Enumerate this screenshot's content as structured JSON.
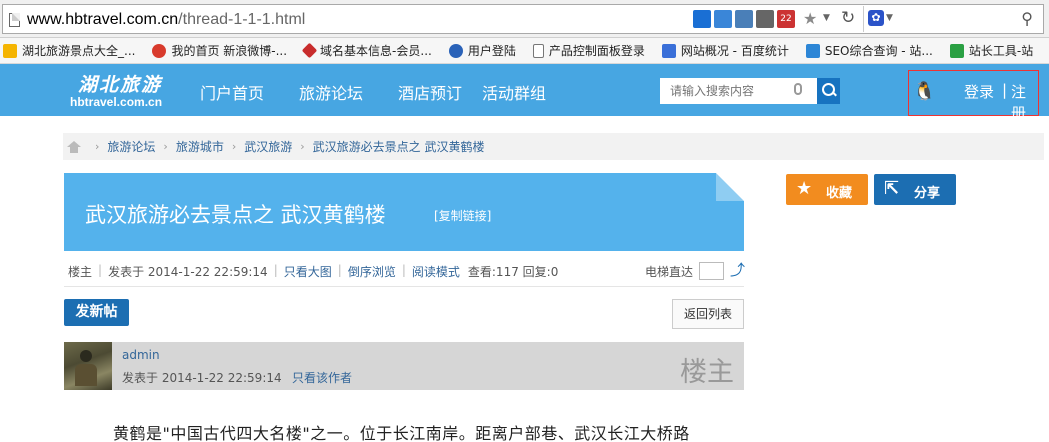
{
  "browser": {
    "url_domain": "www.hbtravel.com.cn",
    "url_path": "/thread-1-1-1.html",
    "badge_count": "22"
  },
  "bookmarks": [
    {
      "label": "湖北旅游景点大全_...",
      "color": "#f5b400"
    },
    {
      "label": "我的首页 新浪微博-...",
      "color": "#d83a2c"
    },
    {
      "label": "域名基本信息-会员...",
      "color": "#c82c2c"
    },
    {
      "label": "用户登陆",
      "color": "#2a62b8"
    },
    {
      "label": "产品控制面板登录",
      "color": "#ffffff"
    },
    {
      "label": "网站概况 - 百度统计",
      "color": "#3a6fd8"
    },
    {
      "label": "SEO综合查询 - 站...",
      "color": "#2d86d6"
    },
    {
      "label": "站长工具-站",
      "color": "#2aa043"
    }
  ],
  "site": {
    "logo_cn": "湖北旅游",
    "logo_en": "hbtravel.com.cn",
    "nav": [
      "门户首页",
      "旅游论坛",
      "酒店预订",
      "活动群组"
    ],
    "search_placeholder": "请输入搜索内容",
    "login": "登录",
    "separator": "|",
    "register": "注册"
  },
  "breadcrumb": [
    "旅游论坛",
    "旅游城市",
    "武汉旅游",
    "武汉旅游必去景点之 武汉黄鹤楼"
  ],
  "thread": {
    "title": "武汉旅游必去景点之 武汉黄鹤楼",
    "copy_link": "[复制链接]",
    "favorite": "收藏",
    "share": "分享"
  },
  "meta": {
    "floor_owner": "楼主",
    "posted": "发表于 2014-1-22 22:59:14",
    "view_big_image": "只看大图",
    "reverse_browse": "倒序浏览",
    "read_mode": "阅读模式",
    "stats": "查看:117 回复:0",
    "elevator": "电梯直达"
  },
  "actions": {
    "new_post": "发新帖",
    "back_to_list": "返回列表"
  },
  "post": {
    "author": "admin",
    "time": "发表于 2014-1-22 22:59:14",
    "only_author": "只看该作者",
    "floor_label": "楼主",
    "body": "黄鹤是\"中国古代四大名楼\"之一。位于长江南岸。距离户部巷、武汉长江大桥路"
  }
}
